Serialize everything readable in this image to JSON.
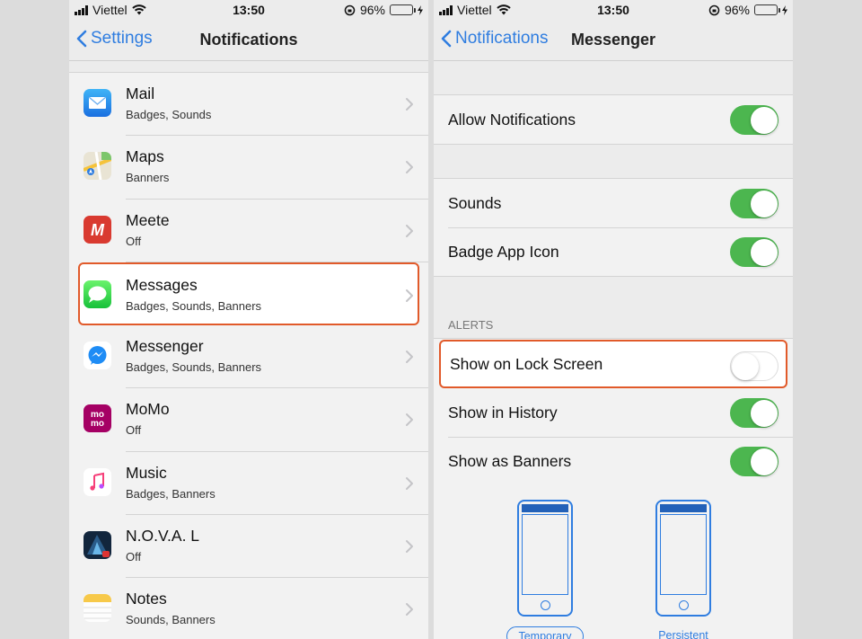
{
  "status": {
    "carrier": "Viettel",
    "time": "13:50",
    "battery": "96%",
    "battery_level": 0.96
  },
  "left": {
    "back_label": "Settings",
    "title": "Notifications",
    "apps": [
      {
        "name": "Mail",
        "sub": "Badges, Sounds",
        "icon": "mail-icon"
      },
      {
        "name": "Maps",
        "sub": "Banners",
        "icon": "maps-icon"
      },
      {
        "name": "Meete",
        "sub": "Off",
        "icon": "meete-icon"
      },
      {
        "name": "Messages",
        "sub": "Badges, Sounds, Banners",
        "icon": "messages-icon",
        "highlighted": true
      },
      {
        "name": "Messenger",
        "sub": "Badges, Sounds, Banners",
        "icon": "messenger-icon"
      },
      {
        "name": "MoMo",
        "sub": "Off",
        "icon": "momo-icon"
      },
      {
        "name": "Music",
        "sub": "Badges, Banners",
        "icon": "music-icon"
      },
      {
        "name": "N.O.V.A. L",
        "sub": "Off",
        "icon": "nova-icon"
      },
      {
        "name": "Notes",
        "sub": "Sounds, Banners",
        "icon": "notes-icon"
      }
    ]
  },
  "right": {
    "back_label": "Notifications",
    "title": "Messenger",
    "allow_notifications": {
      "label": "Allow Notifications",
      "on": true
    },
    "sounds": {
      "label": "Sounds",
      "on": true
    },
    "badge_app_icon": {
      "label": "Badge App Icon",
      "on": true
    },
    "alerts_header": "ALERTS",
    "show_on_lock_screen": {
      "label": "Show on Lock Screen",
      "on": false
    },
    "show_in_history": {
      "label": "Show in History",
      "on": true
    },
    "show_as_banners": {
      "label": "Show as Banners",
      "on": true
    },
    "banner_styles": {
      "temporary": "Temporary",
      "persistent": "Persistent",
      "selected": "Temporary"
    }
  },
  "colors": {
    "accent": "#2f7de0",
    "toggle_on": "#4cb64f",
    "highlight_border": "#e15a2a"
  }
}
